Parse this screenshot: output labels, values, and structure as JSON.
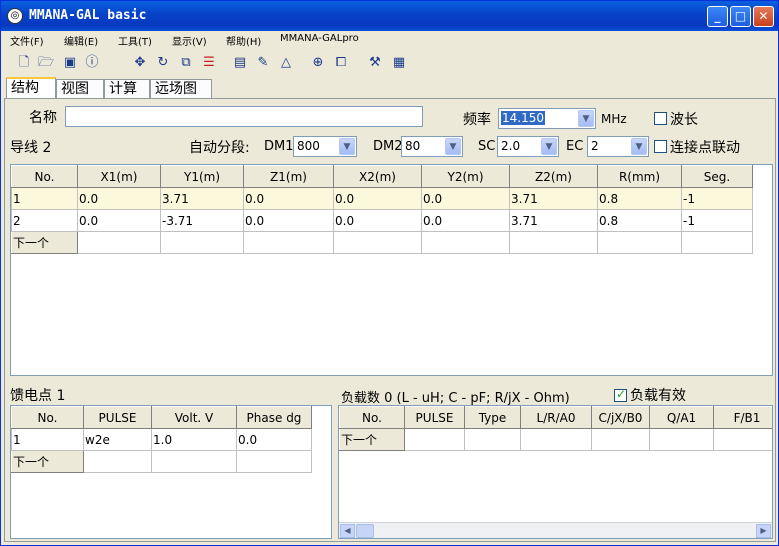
{
  "window": {
    "title": "MMANA-GAL basic",
    "icon": "antenna-app-icon",
    "minimize": "_",
    "maximize": "□",
    "close": "✕"
  },
  "menu": [
    "文件(F)",
    "编辑(E)",
    "工具(T)",
    "显示(V)",
    "帮助(H)",
    "MMANA-GALpro"
  ],
  "toolbar": [
    "new-file-icon",
    "open-folder-icon",
    "save-icon",
    "info-icon",
    "move-icon",
    "rotate-icon",
    "scale-icon",
    "wire-list-icon",
    "document-icon",
    "pen-icon",
    "triangle-icon",
    "target-icon",
    "copy-icon",
    "tools-icon",
    "calculator-icon"
  ],
  "tabs": [
    "结构",
    "视图",
    "计算",
    "远场图"
  ],
  "form": {
    "name_label": "名称",
    "name_value": "",
    "freq_label": "频率",
    "freq_value": "14.150",
    "freq_unit": "MHz",
    "wavelength_label": "波长",
    "wires_label": "导线 2",
    "autoseg_label": "自动分段:",
    "dm1_label": "DM1",
    "dm1_value": "800",
    "dm2_label": "DM2",
    "dm2_value": "80",
    "sc_label": "SC",
    "sc_value": "2.0",
    "ec_label": "EC",
    "ec_value": "2",
    "link_label": "连接点联动"
  },
  "wires": {
    "headers": [
      "No.",
      "X1(m)",
      "Y1(m)",
      "Z1(m)",
      "X2(m)",
      "Y2(m)",
      "Z2(m)",
      "R(mm)",
      "Seg."
    ],
    "rows": [
      [
        "1",
        "0.0",
        "3.71",
        "0.0",
        "0.0",
        "0.0",
        "3.71",
        "0.8",
        "-1"
      ],
      [
        "2",
        "0.0",
        "-3.71",
        "0.0",
        "0.0",
        "0.0",
        "3.71",
        "0.8",
        "-1"
      ]
    ],
    "next_label": "下一个"
  },
  "sources": {
    "label": "馈电点 1",
    "headers": [
      "No.",
      "PULSE",
      "Volt. V",
      "Phase dg"
    ],
    "rows": [
      [
        "1",
        "w2e",
        "1.0",
        "0.0"
      ]
    ],
    "next_label": "下一个"
  },
  "loads": {
    "label": "负载数 0 (L - uH; C - pF; R/jX - Ohm)",
    "enable_label": "负载有效",
    "headers": [
      "No.",
      "PULSE",
      "Type",
      "L/R/A0",
      "C/jX/B0",
      "Q/A1",
      "F/B1"
    ],
    "next_label": "下一个"
  }
}
